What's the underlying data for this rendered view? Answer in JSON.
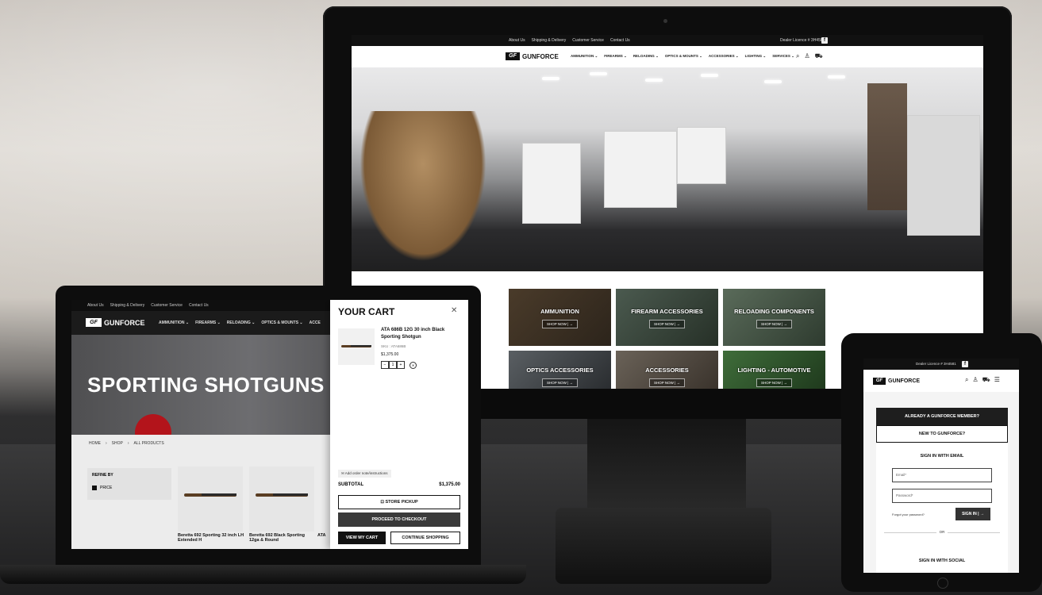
{
  "brand": {
    "logo_mark": "GF",
    "logo_text": "GUNFORCE"
  },
  "desktop": {
    "topbar": {
      "links": [
        "About Us",
        "Shipping & Delivery",
        "Customer Service",
        "Contact Us"
      ],
      "dealer": "Dealer Licence # 3H4581"
    },
    "menu": [
      "AMMUNITION ⌄",
      "FIREARMS ⌄",
      "RELOADING ⌄",
      "OPTICS & MOUNTS ⌄",
      "ACCESSORIES ⌄",
      "LIGHTING ⌄",
      "SERVICES ⌄"
    ],
    "icons": {
      "search": "search-icon",
      "account": "user-icon",
      "cart": "cart-icon"
    },
    "tiles": [
      {
        "name": "AMMUNITION",
        "button": "SHOP NOW | →"
      },
      {
        "name": "FIREARM ACCESSORIES",
        "button": "SHOP NOW | →"
      },
      {
        "name": "RELOADING COMPONENTS",
        "button": "SHOP NOW | →"
      },
      {
        "name": "OPTICS ACCESSORIES",
        "button": "SHOP NOW | →"
      },
      {
        "name": "ACCESSORIES",
        "button": "SHOP NOW | →"
      },
      {
        "name": "LIGHTING - AUTOMOTIVE",
        "button": "SHOP NOW | →"
      }
    ]
  },
  "laptop": {
    "topbar": {
      "links": [
        "About Us",
        "Shipping & Delivery",
        "Customer Service",
        "Contact Us"
      ]
    },
    "menu": [
      "AMMUNITION ⌄",
      "FIREARMS ⌄",
      "RELOADING ⌄",
      "OPTICS & MOUNTS ⌄",
      "ACCE"
    ],
    "hero_title": "SPORTING SHOTGUNS",
    "breadcrumb": [
      "HOME",
      "›",
      "SHOP",
      "›",
      "ALL PRODUCTS"
    ],
    "refine": {
      "heading": "REFINE BY",
      "filter": "PRICE"
    },
    "products": [
      "Beretta 692 Sporting 32 inch LH Extended H",
      "Beretta 692 Black Sporting 12ga & Round",
      "ATA"
    ],
    "cart": {
      "title": "YOUR CART",
      "close": "✕",
      "item_name": "ATA 686B 12G 30 inch Black Sporting Shotgun",
      "sku": "SKU : ATA686B",
      "price": "$1,375.00",
      "qty": "1",
      "qty_minus": "−",
      "qty_plus": "+",
      "remove": "✕",
      "note": "✉ Add order note/instructions",
      "subtotal_label": "SUBTOTAL",
      "subtotal_value": "$1,375.00",
      "pickup": "⊡ STORE PICKUP",
      "checkout": "PROCEED TO CHECKOUT",
      "view_cart": "VIEW MY CART",
      "continue": "CONTINUE SHOPPING"
    }
  },
  "tablet": {
    "dealer": "Dealer Licence # 3H4581",
    "member_tab": "ALREADY A GUNFORCE MEMBER?",
    "new_tab": "NEW TO GUNFORCE?",
    "signin_heading": "SIGN IN WITH EMAIL",
    "email_placeholder": "Email*",
    "password_placeholder": "Password*",
    "forgot": "Forgot your password?",
    "signin_button": "SIGN IN | →",
    "or": "OR",
    "social_heading": "SIGN IN WITH SOCIAL"
  },
  "colors": {
    "dark": "#111111",
    "accent_red": "#b3141b",
    "button_gray": "#3a3a3a"
  }
}
